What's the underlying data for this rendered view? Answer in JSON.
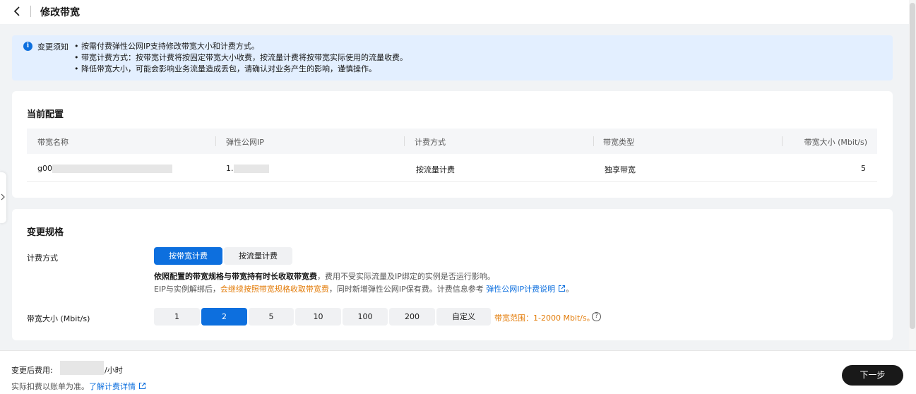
{
  "header": {
    "title": "修改带宽"
  },
  "notice": {
    "label": "变更须知",
    "lines": [
      "• 按需付费弹性公网IP支持修改带宽大小和计费方式。",
      "• 带宽计费方式：按带宽计费将按固定带宽大小收费，按流量计费将按带宽实际使用的流量收费。",
      "• 降低带宽大小，可能会影响业务流量造成丢包，请确认对业务产生的影响，谨慎操作。"
    ]
  },
  "current": {
    "title": "当前配置",
    "columns": [
      "带宽名称",
      "弹性公网IP",
      "计费方式",
      "带宽类型",
      "带宽大小 (Mbit/s)"
    ],
    "row": {
      "name": "g00",
      "ip": "1.",
      "billing": "按流量计费",
      "type": "独享带宽",
      "size": "5"
    }
  },
  "change": {
    "title": "变更规格",
    "billing_label": "计费方式",
    "billing_options": [
      "按带宽计费",
      "按流量计费"
    ],
    "billing_selected": "按带宽计费",
    "desc1_strong": "依照配置的带宽规格与带宽持有时长收取带宽费",
    "desc1_rest": "，费用不受实际流量及IP绑定的实例是否运行影响。",
    "desc2_pre": "EIP与实例解绑后，",
    "desc2_warn": "会继续按照带宽规格收取带宽费",
    "desc2_mid": "，同时新增弹性公网IP保有费。计费信息参考 ",
    "desc2_link": "弹性公网IP计费说明",
    "desc2_end": "。",
    "size_label": "带宽大小 (Mbit/s)",
    "size_options": [
      "1",
      "2",
      "5",
      "10",
      "100",
      "200",
      "自定义"
    ],
    "size_selected": "2",
    "range_note": "带宽范围：1-2000 Mbit/s。",
    "help": "?"
  },
  "footer": {
    "cost_label": "变更后费用:",
    "cost_unit": "/小时",
    "note_text": "实际扣费以账单为准。",
    "note_link": "了解计费详情",
    "next_button": "下一步"
  },
  "colors": {
    "accent": "#0d6fde",
    "warning": "#e37d0b",
    "notice_bg": "#e3efff",
    "primary_button": "#191919"
  }
}
